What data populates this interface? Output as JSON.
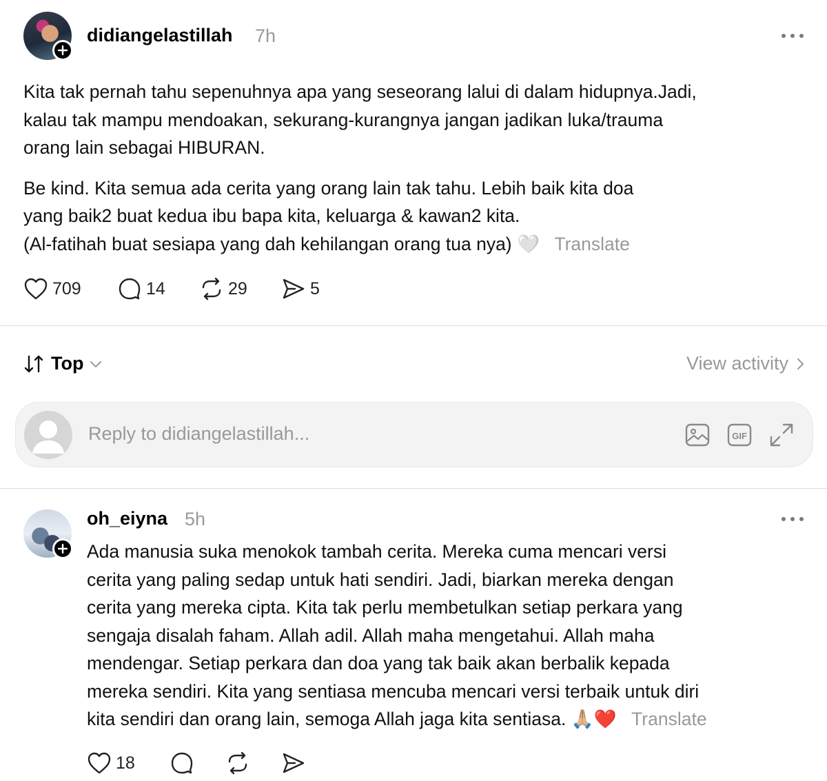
{
  "post": {
    "username": "didiangelastillah",
    "time": "7h",
    "more_icon": "more-icon",
    "paragraphs": [
      [
        "Kita tak pernah tahu sepenuhnya apa yang seseorang lalui di dalam hidupnya.Jadi,",
        "kalau tak mampu mendoakan, sekurang-kurangnya jangan jadikan luka/trauma",
        "orang lain sebagai HIBURAN."
      ],
      [
        "Be kind. Kita semua ada cerita yang orang lain tak tahu. Lebih baik kita doa",
        "yang baik2 buat kedua ibu bapa kita, keluarga & kawan2 kita.",
        "(Al-fatihah buat sesiapa yang dah kehilangan orang tua nya)"
      ]
    ],
    "emoji": "🤍",
    "translate_label": "Translate",
    "actions": {
      "likes": "709",
      "comments": "14",
      "reposts": "29",
      "shares": "5"
    }
  },
  "thread_controls": {
    "sort_label": "Top",
    "view_activity_label": "View activity"
  },
  "reply_box": {
    "placeholder": "Reply to didiangelastillah..."
  },
  "comment": {
    "username": "oh_eiyna",
    "time": "5h",
    "lines": [
      "Ada manusia suka menokok tambah cerita. Mereka cuma mencari versi",
      "cerita yang paling sedap untuk hati sendiri. Jadi, biarkan mereka dengan",
      "cerita yang mereka cipta. Kita tak perlu membetulkan setiap perkara yang",
      "sengaja disalah faham. Allah adil. Allah maha mengetahui. Allah maha",
      "mendengar. Setiap perkara dan doa yang tak baik akan berbalik kepada",
      "mereka sendiri. Kita yang sentiasa mencuba mencari versi terbaik untuk diri",
      "kita sendiri dan orang lain, semoga Allah jaga kita sentiasa."
    ],
    "emoji": "🙏🏼❤️",
    "translate_label": "Translate",
    "actions": {
      "likes": "18"
    }
  }
}
